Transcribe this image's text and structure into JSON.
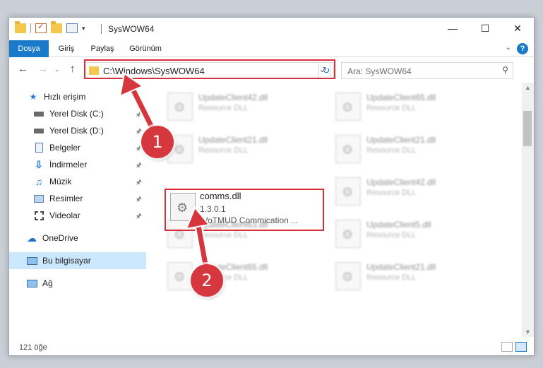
{
  "window": {
    "title": "SysWOW64"
  },
  "ribbon": {
    "tabs": [
      {
        "label": "Dosya"
      },
      {
        "label": "Giriş"
      },
      {
        "label": "Paylaş"
      },
      {
        "label": "Görünüm"
      }
    ],
    "help": "?"
  },
  "address": {
    "path": "C:\\Windows\\SysWOW64"
  },
  "search": {
    "placeholder": "Ara: SysWOW64"
  },
  "sidebar": {
    "items": [
      {
        "label": "Hızlı erişim",
        "icon": "star-icon"
      },
      {
        "label": "Yerel Disk (C:)",
        "icon": "drive-icon"
      },
      {
        "label": "Yerel Disk (D:)",
        "icon": "drive-icon"
      },
      {
        "label": "Belgeler",
        "icon": "documents-icon"
      },
      {
        "label": "İndirmeler",
        "icon": "download-icon"
      },
      {
        "label": "Müzik",
        "icon": "music-icon"
      },
      {
        "label": "Resimler",
        "icon": "pictures-icon"
      },
      {
        "label": "Videolar",
        "icon": "video-icon"
      },
      {
        "label": "OneDrive",
        "icon": "cloud-icon"
      },
      {
        "label": "Bu bilgisayar",
        "icon": "computer-icon"
      },
      {
        "label": "Ağ",
        "icon": "network-icon"
      }
    ]
  },
  "files": [
    {
      "name": "UpdateClient42.dll",
      "desc": "Resource DLL"
    },
    {
      "name": "UpdateClient65.dll",
      "desc": "Resource DLL"
    },
    {
      "name": "UpdateClient21.dll",
      "desc": "Resource DLL"
    },
    {
      "name": "UpdateClient21.dll",
      "desc": "Resource DLL"
    },
    {
      "name": "UpdateClient42.dll",
      "desc": "Resource DLL"
    },
    {
      "name": "UpdateClient63.dll",
      "desc": "Resource DLL"
    },
    {
      "name": "UpdateClient5.dll",
      "desc": "Resource DLL"
    },
    {
      "name": "UpdateClient65.dll",
      "desc": "Resource DLL"
    },
    {
      "name": "UpdateClient21.dll",
      "desc": "Resource DLL"
    }
  ],
  "focus_file": {
    "name": "comms.dll",
    "version": "1.3.0.1",
    "desc": "WoTMUD Commication ..."
  },
  "status": {
    "count": "121 öğe"
  },
  "annotations": {
    "badge1": "1",
    "badge2": "2",
    "color": "#d6363d"
  }
}
